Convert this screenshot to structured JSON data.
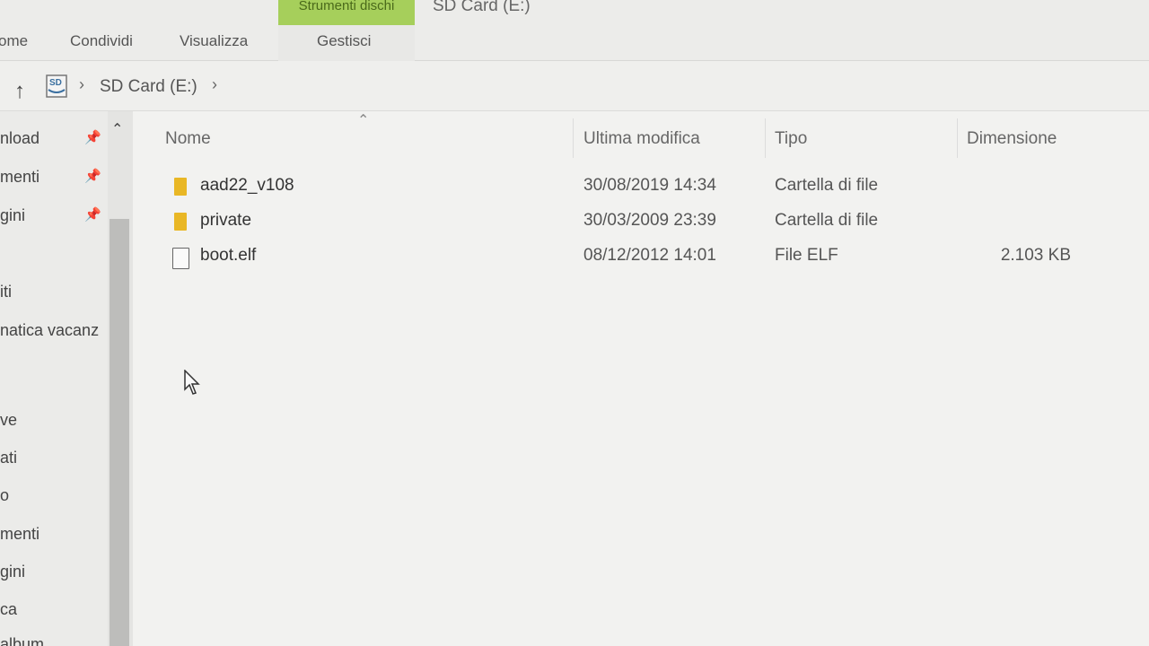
{
  "window": {
    "title": "SD Card (E:)"
  },
  "ribbon": {
    "context_group": "Strumenti dischi",
    "tabs": [
      "ome",
      "Condividi",
      "Visualizza",
      "Gestisci"
    ]
  },
  "address": {
    "drive_label": "SD",
    "crumb": "SD Card (E:)"
  },
  "nav": {
    "items": [
      {
        "label": "nload",
        "pinned": true
      },
      {
        "label": "menti",
        "pinned": true
      },
      {
        "label": "gini",
        "pinned": true
      },
      {
        "label": "iti",
        "pinned": false
      },
      {
        "label": "natica vacanz",
        "pinned": false
      },
      {
        "label": "ve",
        "pinned": false
      },
      {
        "label": "ati",
        "pinned": false
      },
      {
        "label": "o",
        "pinned": false
      },
      {
        "label": "menti",
        "pinned": false
      },
      {
        "label": "gini",
        "pinned": false
      },
      {
        "label": "ca",
        "pinned": false
      },
      {
        "label": "album",
        "pinned": false
      }
    ]
  },
  "columns": {
    "name": "Nome",
    "modified": "Ultima modifica",
    "type": "Tipo",
    "size": "Dimensione"
  },
  "files": [
    {
      "name": "aad22_v108",
      "modified": "30/08/2019 14:34",
      "type": "Cartella di file",
      "size": "",
      "icon": "folder-icon"
    },
    {
      "name": "private",
      "modified": "30/03/2009 23:39",
      "type": "Cartella di file",
      "size": "",
      "icon": "folder-icon"
    },
    {
      "name": "boot.elf",
      "modified": "08/12/2012 14:01",
      "type": "File ELF",
      "size": "2.103 KB",
      "icon": "file-icon"
    }
  ],
  "colors": {
    "context_tab": "#a6cf5b",
    "folder": "#e9b725"
  }
}
